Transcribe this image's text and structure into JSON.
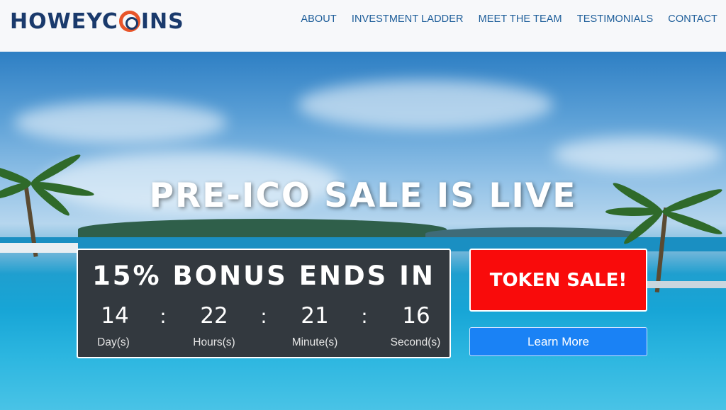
{
  "header": {
    "logo_text": "HOWEYCOINS",
    "logo_prefix": "HOWEYC",
    "logo_suffix": "INS",
    "nav": [
      "ABOUT",
      "INVESTMENT LADDER",
      "MEET THE TEAM",
      "TESTIMONIALS",
      "CONTACT"
    ]
  },
  "hero": {
    "headline": "PRE-ICO SALE IS LIVE",
    "countdown": {
      "title": "15% BONUS ENDS IN",
      "days": "14",
      "hours": "22",
      "minutes": "21",
      "seconds": "16",
      "separator": ":",
      "days_label": "Day(s)",
      "hours_label": "Hours(s)",
      "minutes_label": "Minute(s)",
      "seconds_label": "Second(s)"
    },
    "token_button": "TOKEN SALE!",
    "learn_button": "Learn More"
  },
  "colors": {
    "nav_text": "#1d5d99",
    "logo_blue": "#1a3a6c",
    "logo_orange": "#e8552a",
    "token_red": "#f90b0b",
    "learn_blue": "#1a82f5",
    "countdown_bg": "#33393f"
  }
}
